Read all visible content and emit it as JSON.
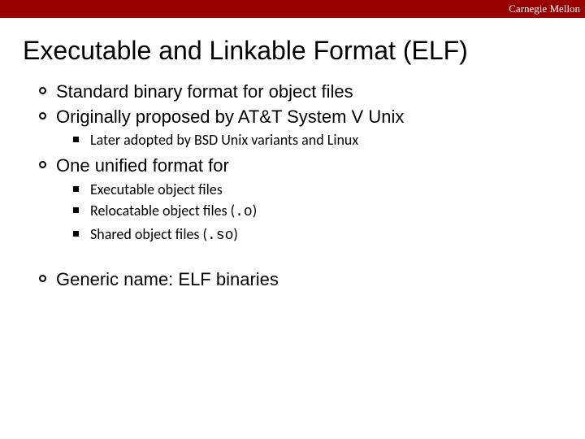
{
  "brand": "Carnegie Mellon",
  "title": "Executable and Linkable Format (ELF)",
  "bullets": {
    "b1": "Standard binary format for object files",
    "b2": "Originally proposed by AT&T System V Unix",
    "b2_1": "Later adopted by BSD Unix variants and Linux",
    "b3": "One unified format for",
    "b3_1": "Executable object files",
    "b3_2_a": "Relocatable object files (",
    "b3_2_code": ".o",
    "b3_2_b": ")",
    "b3_3_a": "Shared object files (",
    "b3_3_code": ".so",
    "b3_3_b": ")",
    "b4": "Generic name: ELF binaries"
  }
}
